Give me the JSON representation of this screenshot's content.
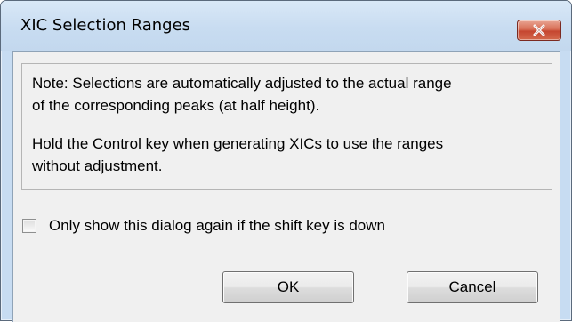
{
  "window": {
    "title": "XIC Selection Ranges",
    "close_icon": "close-x-icon"
  },
  "note": {
    "line1": "Note: Selections are automatically adjusted to the actual range",
    "line2": "of the corresponding peaks (at half height).",
    "line3": "Hold the Control key when generating XICs to use the ranges",
    "line4": "without adjustment."
  },
  "checkbox": {
    "label": "Only show this dialog again if the shift key is down",
    "checked": false
  },
  "buttons": {
    "ok_label": "OK",
    "cancel_label": "Cancel"
  },
  "colors": {
    "titlebar": "#c8dcf1",
    "close_button": "#c54630",
    "client_background": "#f0f0f0"
  }
}
